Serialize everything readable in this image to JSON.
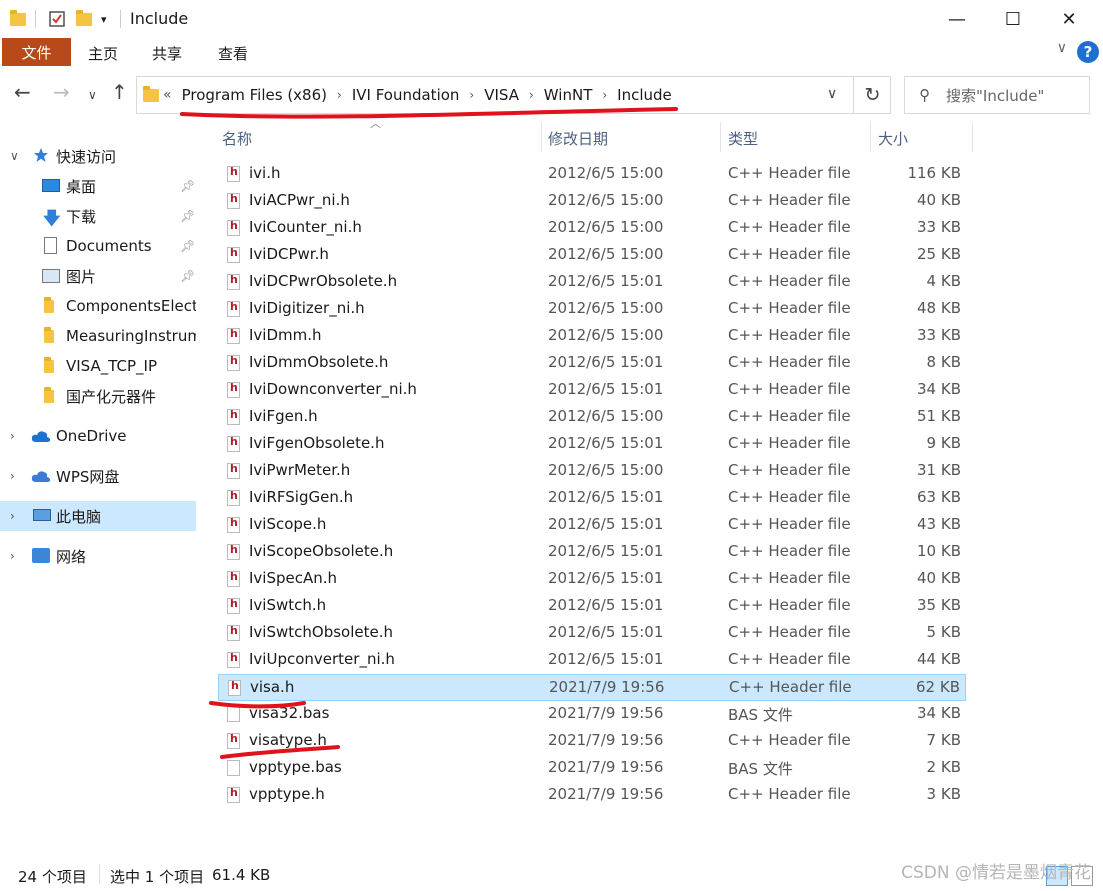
{
  "window": {
    "title": "Include"
  },
  "window_controls": {
    "minimize": "—",
    "maximize": "☐",
    "close": "✕"
  },
  "ribbon": {
    "file": "文件",
    "home": "主页",
    "share": "共享",
    "view": "查看"
  },
  "address": {
    "prefix": "«",
    "crumbs": [
      "Program Files (x86)",
      "IVI Foundation",
      "VISA",
      "WinNT",
      "Include"
    ]
  },
  "search": {
    "placeholder": "搜索\"Include\""
  },
  "nav": {
    "quick_access": "快速访问",
    "items": [
      "桌面",
      "下载",
      "Documents",
      "图片",
      "ComponentsElect",
      "MeasuringInstrum",
      "VISA_TCP_IP",
      "国产化元器件"
    ],
    "onedrive": "OneDrive",
    "wps": "WPS网盘",
    "this_pc": "此电脑",
    "network": "网络"
  },
  "columns": {
    "name": "名称",
    "date": "修改日期",
    "type": "类型",
    "size": "大小"
  },
  "files": [
    {
      "name": "ivi.h",
      "date": "2012/6/5 15:00",
      "type": "C++ Header file",
      "size": "116 KB"
    },
    {
      "name": "IviACPwr_ni.h",
      "date": "2012/6/5 15:00",
      "type": "C++ Header file",
      "size": "40 KB"
    },
    {
      "name": "IviCounter_ni.h",
      "date": "2012/6/5 15:00",
      "type": "C++ Header file",
      "size": "33 KB"
    },
    {
      "name": "IviDCPwr.h",
      "date": "2012/6/5 15:00",
      "type": "C++ Header file",
      "size": "25 KB"
    },
    {
      "name": "IviDCPwrObsolete.h",
      "date": "2012/6/5 15:01",
      "type": "C++ Header file",
      "size": "4 KB"
    },
    {
      "name": "IviDigitizer_ni.h",
      "date": "2012/6/5 15:00",
      "type": "C++ Header file",
      "size": "48 KB"
    },
    {
      "name": "IviDmm.h",
      "date": "2012/6/5 15:00",
      "type": "C++ Header file",
      "size": "33 KB"
    },
    {
      "name": "IviDmmObsolete.h",
      "date": "2012/6/5 15:01",
      "type": "C++ Header file",
      "size": "8 KB"
    },
    {
      "name": "IviDownconverter_ni.h",
      "date": "2012/6/5 15:01",
      "type": "C++ Header file",
      "size": "34 KB"
    },
    {
      "name": "IviFgen.h",
      "date": "2012/6/5 15:00",
      "type": "C++ Header file",
      "size": "51 KB"
    },
    {
      "name": "IviFgenObsolete.h",
      "date": "2012/6/5 15:01",
      "type": "C++ Header file",
      "size": "9 KB"
    },
    {
      "name": "IviPwrMeter.h",
      "date": "2012/6/5 15:00",
      "type": "C++ Header file",
      "size": "31 KB"
    },
    {
      "name": "IviRFSigGen.h",
      "date": "2012/6/5 15:01",
      "type": "C++ Header file",
      "size": "63 KB"
    },
    {
      "name": "IviScope.h",
      "date": "2012/6/5 15:01",
      "type": "C++ Header file",
      "size": "43 KB"
    },
    {
      "name": "IviScopeObsolete.h",
      "date": "2012/6/5 15:01",
      "type": "C++ Header file",
      "size": "10 KB"
    },
    {
      "name": "IviSpecAn.h",
      "date": "2012/6/5 15:01",
      "type": "C++ Header file",
      "size": "40 KB"
    },
    {
      "name": "IviSwtch.h",
      "date": "2012/6/5 15:01",
      "type": "C++ Header file",
      "size": "35 KB"
    },
    {
      "name": "IviSwtchObsolete.h",
      "date": "2012/6/5 15:01",
      "type": "C++ Header file",
      "size": "5 KB"
    },
    {
      "name": "IviUpconverter_ni.h",
      "date": "2012/6/5 15:01",
      "type": "C++ Header file",
      "size": "44 KB"
    },
    {
      "name": "visa.h",
      "date": "2021/7/9 19:56",
      "type": "C++ Header file",
      "size": "62 KB",
      "selected": true
    },
    {
      "name": "visa32.bas",
      "date": "2021/7/9 19:56",
      "type": "BAS 文件",
      "size": "34 KB"
    },
    {
      "name": "visatype.h",
      "date": "2021/7/9 19:56",
      "type": "C++ Header file",
      "size": "7 KB"
    },
    {
      "name": "vpptype.bas",
      "date": "2021/7/9 19:56",
      "type": "BAS 文件",
      "size": "2 KB"
    },
    {
      "name": "vpptype.h",
      "date": "2021/7/9 19:56",
      "type": "C++ Header file",
      "size": "3 KB"
    }
  ],
  "status": {
    "count": "24 个项目",
    "selection": "选中 1 个项目",
    "selected_size": "61.4 KB"
  },
  "watermark": "CSDN @情若是墨烟青花",
  "colors": {
    "ribbon_file": "#b84a19",
    "selection": "#cce8ff",
    "annotation": "#e0121b"
  },
  "icons": [
    "folder-icon",
    "checkbox-icon",
    "back-arrow-icon",
    "forward-arrow-icon",
    "up-arrow-icon",
    "refresh-icon",
    "search-icon",
    "help-icon",
    "star-icon",
    "pin-icon",
    "header-file-icon",
    "generic-file-icon"
  ]
}
